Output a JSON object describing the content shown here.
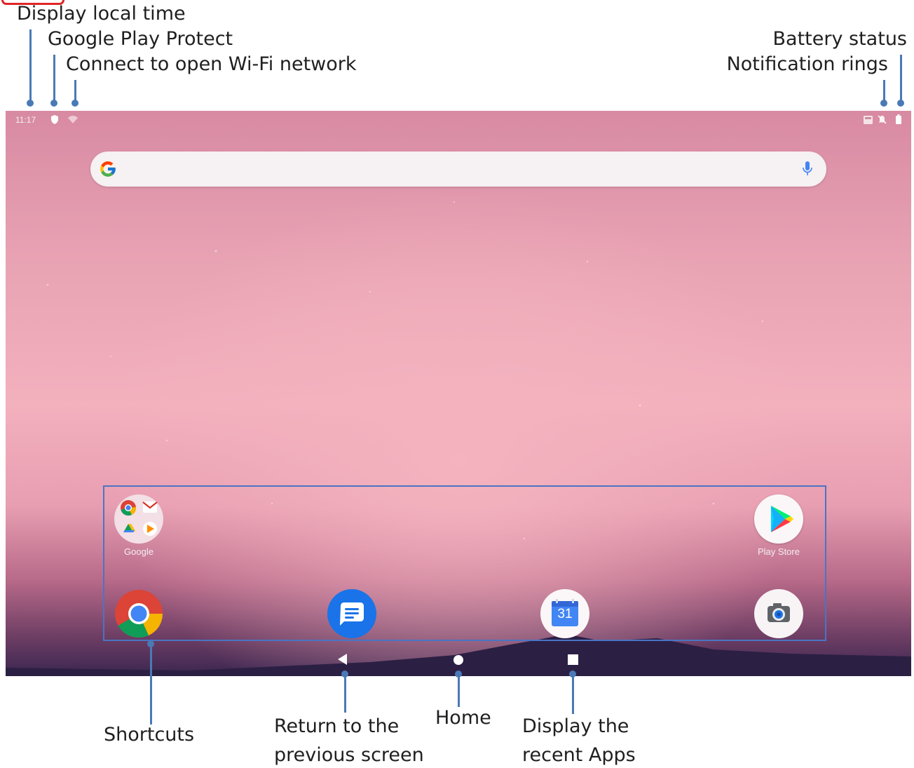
{
  "callouts": {
    "local_time": "Display local time",
    "play_protect": "Google Play Protect",
    "wifi": "Connect to open Wi-Fi network",
    "battery": "Battery status",
    "notification": "Notification rings",
    "shortcuts": "Shortcuts",
    "back_line1": "Return to the",
    "back_line2": "previous screen",
    "home": "Home",
    "recent_line1": "Display the",
    "recent_line2": "recent Apps"
  },
  "statusbar": {
    "time": "11:17"
  },
  "apps": {
    "google_folder_label": "Google",
    "play_store_label": "Play Store",
    "calendar_day": "31"
  },
  "colors": {
    "callout_line": "#4a7ab5",
    "highlight_box": "#4a74c4"
  },
  "icons": [
    "shield-icon",
    "wifi-icon",
    "battery-icon",
    "mute-icon",
    "search-icon",
    "mic-icon",
    "chrome-icon",
    "messages-icon",
    "calendar-icon",
    "camera-icon",
    "play-store-icon",
    "back-icon",
    "home-icon",
    "recents-icon"
  ]
}
